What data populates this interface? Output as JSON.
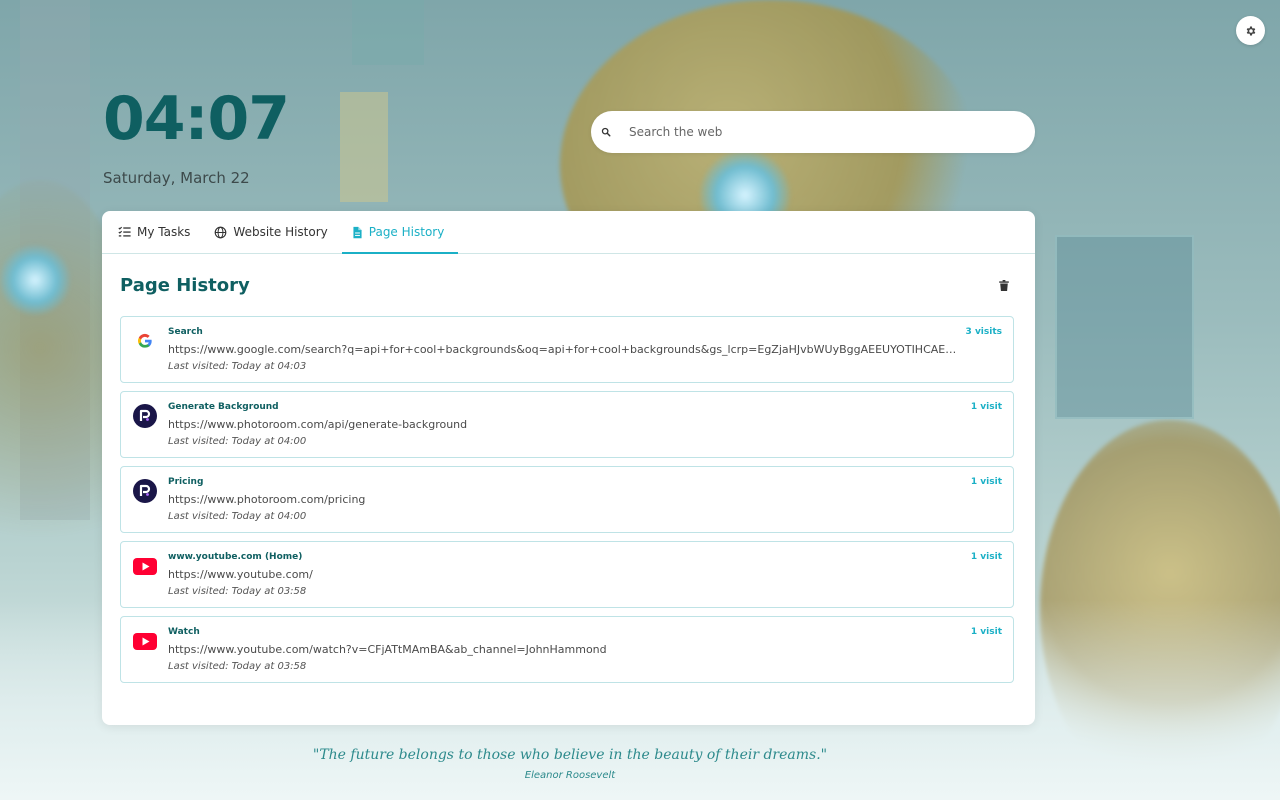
{
  "clock": {
    "time": "04:07",
    "date": "Saturday, March 22"
  },
  "search": {
    "placeholder": "Search the web"
  },
  "tabs": [
    {
      "label": "My Tasks",
      "icon": "checklist-icon"
    },
    {
      "label": "Website History",
      "icon": "globe-icon"
    },
    {
      "label": "Page History",
      "icon": "document-icon",
      "active": true
    }
  ],
  "section": {
    "title": "Page History"
  },
  "history": [
    {
      "title": "Search",
      "url": "https://www.google.com/search?q=api+for+cool+backgrounds&oq=api+for+cool+backgrounds&gs_lcrp=EgZjaHJvbWUyBggAEEUYOTIHCAEQIRig…",
      "last_visited": "Last visited: Today at 04:03",
      "visits": "3 visits",
      "icon": "google-icon"
    },
    {
      "title": "Generate Background",
      "url": "https://www.photoroom.com/api/generate-background",
      "last_visited": "Last visited: Today at 04:00",
      "visits": "1 visit",
      "icon": "photoroom-icon"
    },
    {
      "title": "Pricing",
      "url": "https://www.photoroom.com/pricing",
      "last_visited": "Last visited: Today at 04:00",
      "visits": "1 visit",
      "icon": "photoroom-icon"
    },
    {
      "title": "www.youtube.com (Home)",
      "url": "https://www.youtube.com/",
      "last_visited": "Last visited: Today at 03:58",
      "visits": "1 visit",
      "icon": "youtube-icon"
    },
    {
      "title": "Watch",
      "url": "https://www.youtube.com/watch?v=CFjATtMAmBA&ab_channel=JohnHammond",
      "last_visited": "Last visited: Today at 03:58",
      "visits": "1 visit",
      "icon": "youtube-icon"
    }
  ],
  "quote": {
    "text": "\"The future belongs to those who believe in the beauty of their dreams.\"",
    "author": "Eleanor Roosevelt"
  },
  "colors": {
    "accent": "#1bb0c6",
    "title": "#0f5f61",
    "border": "#bfe3e6"
  }
}
